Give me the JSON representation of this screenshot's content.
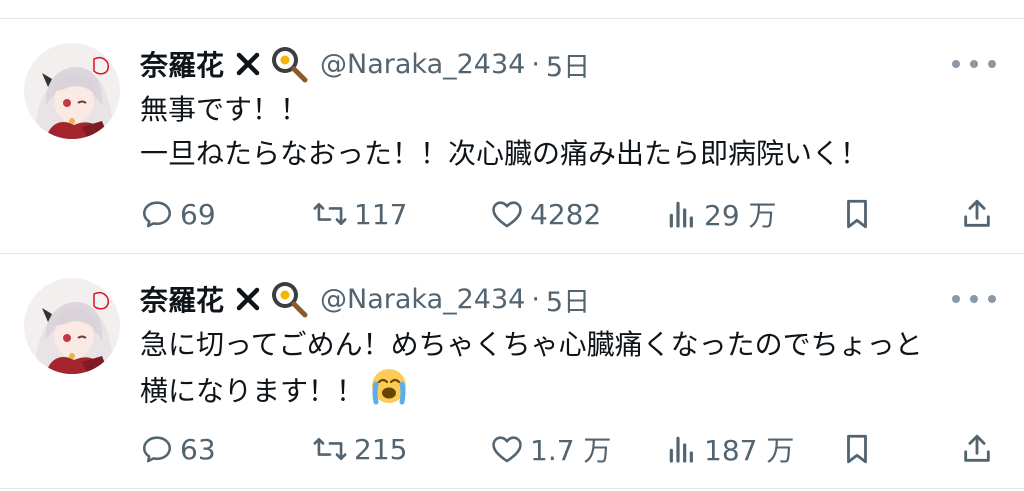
{
  "tweets": [
    {
      "name": "奈羅花",
      "handle": "@Naraka_2434",
      "separator": "·",
      "time": "5日",
      "lines": [
        "無事です！！",
        "一旦ねたらなおった！！次心臓の痛み出たら即病院いく！"
      ],
      "stats": {
        "replies": "69",
        "retweets": "117",
        "likes": "4282",
        "views": "29 万"
      }
    },
    {
      "name": "奈羅花",
      "handle": "@Naraka_2434",
      "separator": "·",
      "time": "5日",
      "lines": [
        "急に切ってごめん！めちゃくちゃ心臓痛くなったのでちょっと",
        "横になります！！"
      ],
      "stats": {
        "replies": "63",
        "retweets": "215",
        "likes": "1.7 万",
        "views": "187 万"
      }
    }
  ],
  "icons": [
    "avatar",
    "x-mark-icon",
    "frying-pan-icon",
    "more-icon",
    "reply-icon",
    "retweet-icon",
    "like-icon",
    "views-icon",
    "bookmark-icon",
    "share-icon",
    "crying-emoji-icon"
  ],
  "colors": {
    "text": "#0f1419",
    "secondary": "#536471",
    "divider": "#e4e7ea"
  }
}
